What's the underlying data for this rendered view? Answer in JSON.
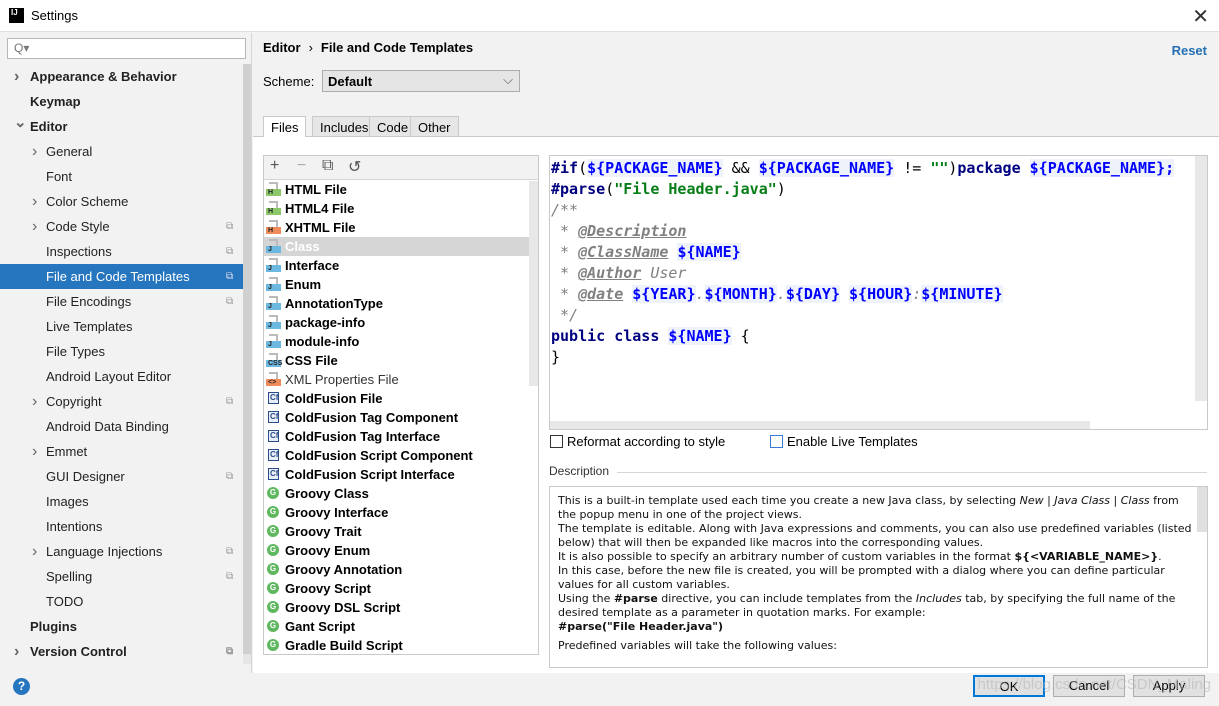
{
  "window": {
    "title": "Settings",
    "app_icon": "IJ"
  },
  "search": {
    "placeholder": "Q▾"
  },
  "sidebar": {
    "items": [
      {
        "label": "Appearance & Behavior",
        "level": 0,
        "bold": true,
        "arrow": "right"
      },
      {
        "label": "Keymap",
        "level": 0,
        "bold": true
      },
      {
        "label": "Editor",
        "level": 0,
        "bold": true,
        "arrow": "down"
      },
      {
        "label": "General",
        "level": 1,
        "arrow": "right"
      },
      {
        "label": "Font",
        "level": 1
      },
      {
        "label": "Color Scheme",
        "level": 1,
        "arrow": "right"
      },
      {
        "label": "Code Style",
        "level": 1,
        "arrow": "right",
        "project": true
      },
      {
        "label": "Inspections",
        "level": 1,
        "project": true
      },
      {
        "label": "File and Code Templates",
        "level": 1,
        "project": true,
        "selected": true
      },
      {
        "label": "File Encodings",
        "level": 1,
        "project": true
      },
      {
        "label": "Live Templates",
        "level": 1
      },
      {
        "label": "File Types",
        "level": 1
      },
      {
        "label": "Android Layout Editor",
        "level": 1
      },
      {
        "label": "Copyright",
        "level": 1,
        "arrow": "right",
        "project": true
      },
      {
        "label": "Android Data Binding",
        "level": 1
      },
      {
        "label": "Emmet",
        "level": 1,
        "arrow": "right"
      },
      {
        "label": "GUI Designer",
        "level": 1,
        "project": true
      },
      {
        "label": "Images",
        "level": 1
      },
      {
        "label": "Intentions",
        "level": 1
      },
      {
        "label": "Language Injections",
        "level": 1,
        "arrow": "right",
        "project": true
      },
      {
        "label": "Spelling",
        "level": 1,
        "project": true
      },
      {
        "label": "TODO",
        "level": 1
      },
      {
        "label": "Plugins",
        "level": 0,
        "bold": true
      },
      {
        "label": "Version Control",
        "level": 0,
        "bold": true,
        "arrow": "right",
        "project": true
      }
    ]
  },
  "breadcrumb": {
    "parent": "Editor",
    "sep": "›",
    "current": "File and Code Templates"
  },
  "reset_label": "Reset",
  "scheme": {
    "label": "Scheme:",
    "value": "Default"
  },
  "tabs": [
    "Files",
    "Includes",
    "Code",
    "Other"
  ],
  "active_tab": "Files",
  "templates": [
    {
      "label": "HTML File",
      "icon": "html",
      "badge": "H",
      "color": "#8cc76a"
    },
    {
      "label": "HTML4 File",
      "icon": "html",
      "badge": "H",
      "color": "#8cc76a"
    },
    {
      "label": "XHTML File",
      "icon": "xhtml",
      "badge": "H",
      "color": "#f08b5c"
    },
    {
      "label": "Class",
      "icon": "java",
      "badge": "J",
      "color": "#6cb8e0",
      "selected": true
    },
    {
      "label": "Interface",
      "icon": "java",
      "badge": "J",
      "color": "#6cb8e0"
    },
    {
      "label": "Enum",
      "icon": "java",
      "badge": "J",
      "color": "#6cb8e0"
    },
    {
      "label": "AnnotationType",
      "icon": "java",
      "badge": "J",
      "color": "#6cb8e0"
    },
    {
      "label": "package-info",
      "icon": "java",
      "badge": "J",
      "color": "#6cb8e0"
    },
    {
      "label": "module-info",
      "icon": "java",
      "badge": "J",
      "color": "#6cb8e0"
    },
    {
      "label": "CSS File",
      "icon": "css",
      "badge": "CSS",
      "color": "#6cb8e0"
    },
    {
      "label": "XML Properties File",
      "icon": "xml",
      "badge": "<>",
      "color": "#f08b5c",
      "plain": true
    },
    {
      "label": "ColdFusion File",
      "icon": "cf",
      "badge": "Cf"
    },
    {
      "label": "ColdFusion Tag Component",
      "icon": "cf",
      "badge": "Cf"
    },
    {
      "label": "ColdFusion Tag Interface",
      "icon": "cf",
      "badge": "Cf"
    },
    {
      "label": "ColdFusion Script Component",
      "icon": "cf",
      "badge": "Cf"
    },
    {
      "label": "ColdFusion Script Interface",
      "icon": "cf",
      "badge": "Cf"
    },
    {
      "label": "Groovy Class",
      "icon": "groovy",
      "badge": "G"
    },
    {
      "label": "Groovy Interface",
      "icon": "groovy",
      "badge": "G"
    },
    {
      "label": "Groovy Trait",
      "icon": "groovy",
      "badge": "G"
    },
    {
      "label": "Groovy Enum",
      "icon": "groovy",
      "badge": "G"
    },
    {
      "label": "Groovy Annotation",
      "icon": "groovy",
      "badge": "G"
    },
    {
      "label": "Groovy Script",
      "icon": "groovy",
      "badge": "G"
    },
    {
      "label": "Groovy DSL Script",
      "icon": "groovy",
      "badge": "G"
    },
    {
      "label": "Gant Script",
      "icon": "groovy",
      "badge": "G"
    },
    {
      "label": "Gradle Build Script",
      "icon": "groovy",
      "badge": "G"
    }
  ],
  "toolbar": {
    "add": "+",
    "remove": "−",
    "copy": "⧉",
    "reset": "↺"
  },
  "code": [
    [
      [
        "kw",
        "#if"
      ],
      [
        "",
        "("
      ],
      [
        "var",
        "${PACKAGE_NAME}"
      ],
      [
        "",
        " && "
      ],
      [
        "var",
        "${PACKAGE_NAME}"
      ],
      [
        "",
        " != "
      ],
      [
        "str",
        "\"\""
      ],
      [
        "",
        ")"
      ],
      [
        "kw",
        "package"
      ],
      [
        "",
        " "
      ],
      [
        "var",
        "${PACKAGE_NAME};"
      ]
    ],
    [
      [
        "kw",
        "#parse"
      ],
      [
        "",
        "("
      ],
      [
        "str",
        "\"File Header.java\""
      ],
      [
        "",
        ")"
      ]
    ],
    [
      [
        "cm",
        "/**"
      ]
    ],
    [
      [
        "cm",
        " * "
      ],
      [
        "tag",
        "@Description"
      ]
    ],
    [
      [
        "cm",
        " * "
      ],
      [
        "tag",
        "@ClassName"
      ],
      [
        "",
        " "
      ],
      [
        "var",
        "${NAME}"
      ]
    ],
    [
      [
        "cm",
        " * "
      ],
      [
        "tag",
        "@Author"
      ],
      [
        "cm",
        " User"
      ]
    ],
    [
      [
        "cm",
        " * "
      ],
      [
        "tag",
        "@date"
      ],
      [
        "",
        " "
      ],
      [
        "var",
        "${YEAR}"
      ],
      [
        "cm",
        "."
      ],
      [
        "var",
        "${MONTH}"
      ],
      [
        "cm",
        "."
      ],
      [
        "var",
        "${DAY}"
      ],
      [
        "",
        " "
      ],
      [
        "var",
        "${HOUR}"
      ],
      [
        "cm",
        ":"
      ],
      [
        "var",
        "${MINUTE}"
      ]
    ],
    [
      [
        "cm",
        " */"
      ]
    ],
    [
      [
        "kw",
        "public class "
      ],
      [
        "var",
        "${NAME}"
      ],
      [
        "",
        " {"
      ]
    ],
    [
      [
        "",
        "}"
      ]
    ]
  ],
  "options": {
    "reformat": "Reformat according to style",
    "live_templates": "Enable Live Templates"
  },
  "description": {
    "label": "Description",
    "p1a": "This is a built-in template used each time you create a new Java class, by selecting ",
    "p1b": "New | Java Class | Class",
    "p1c": " from the popup menu in one of the project views.",
    "p2": "The template is editable. Along with Java expressions and comments, you can also use predefined variables (listed below) that will then be expanded like macros into the corresponding values.",
    "p3a": "It is also possible to specify an arbitrary number of custom variables in the format ",
    "p3b": "${<VARIABLE_NAME>}",
    "p3c": ".",
    "p4": "In this case, before the new file is created, you will be prompted with a dialog where you can define particular values for all custom variables.",
    "p5a": "Using the ",
    "p5b": "#parse",
    "p5c": " directive, you can include templates from the ",
    "p5d": "Includes",
    "p5e": " tab, by specifying the full name of the desired template as a parameter in quotation marks. For example:",
    "p6": "#parse(\"File Header.java\")",
    "p7": "Predefined variables will take the following values:"
  },
  "footer": {
    "help": "?",
    "ok": "OK",
    "cancel": "Cancel",
    "apply": "Apply",
    "watermark": "https://blog.csdn.net/CSDN_Maling"
  }
}
